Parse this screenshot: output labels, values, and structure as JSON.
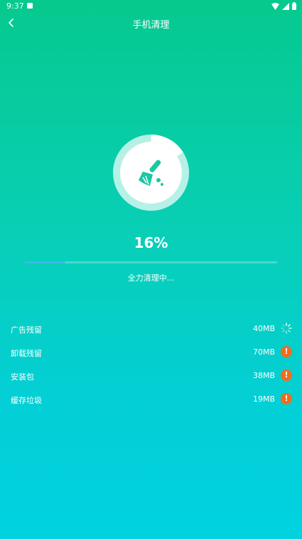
{
  "status_bar": {
    "time": "9:37"
  },
  "header": {
    "title": "手机清理"
  },
  "progress": {
    "percent_label": "16%",
    "value": 0.16,
    "status": "全力清理中..."
  },
  "items": [
    {
      "label": "广告残留",
      "size": "40MB",
      "state": "loading"
    },
    {
      "label": "卸载残留",
      "size": "70MB",
      "state": "warning"
    },
    {
      "label": "安装包",
      "size": "38MB",
      "state": "warning"
    },
    {
      "label": "缓存垃圾",
      "size": "19MB",
      "state": "warning"
    }
  ],
  "colors": {
    "accent": "#06c98e",
    "progress_fill": "#3fb8e9",
    "warning": "#f06d1c"
  },
  "icons": {
    "center": "broom-icon",
    "back": "back-arrow-icon"
  }
}
